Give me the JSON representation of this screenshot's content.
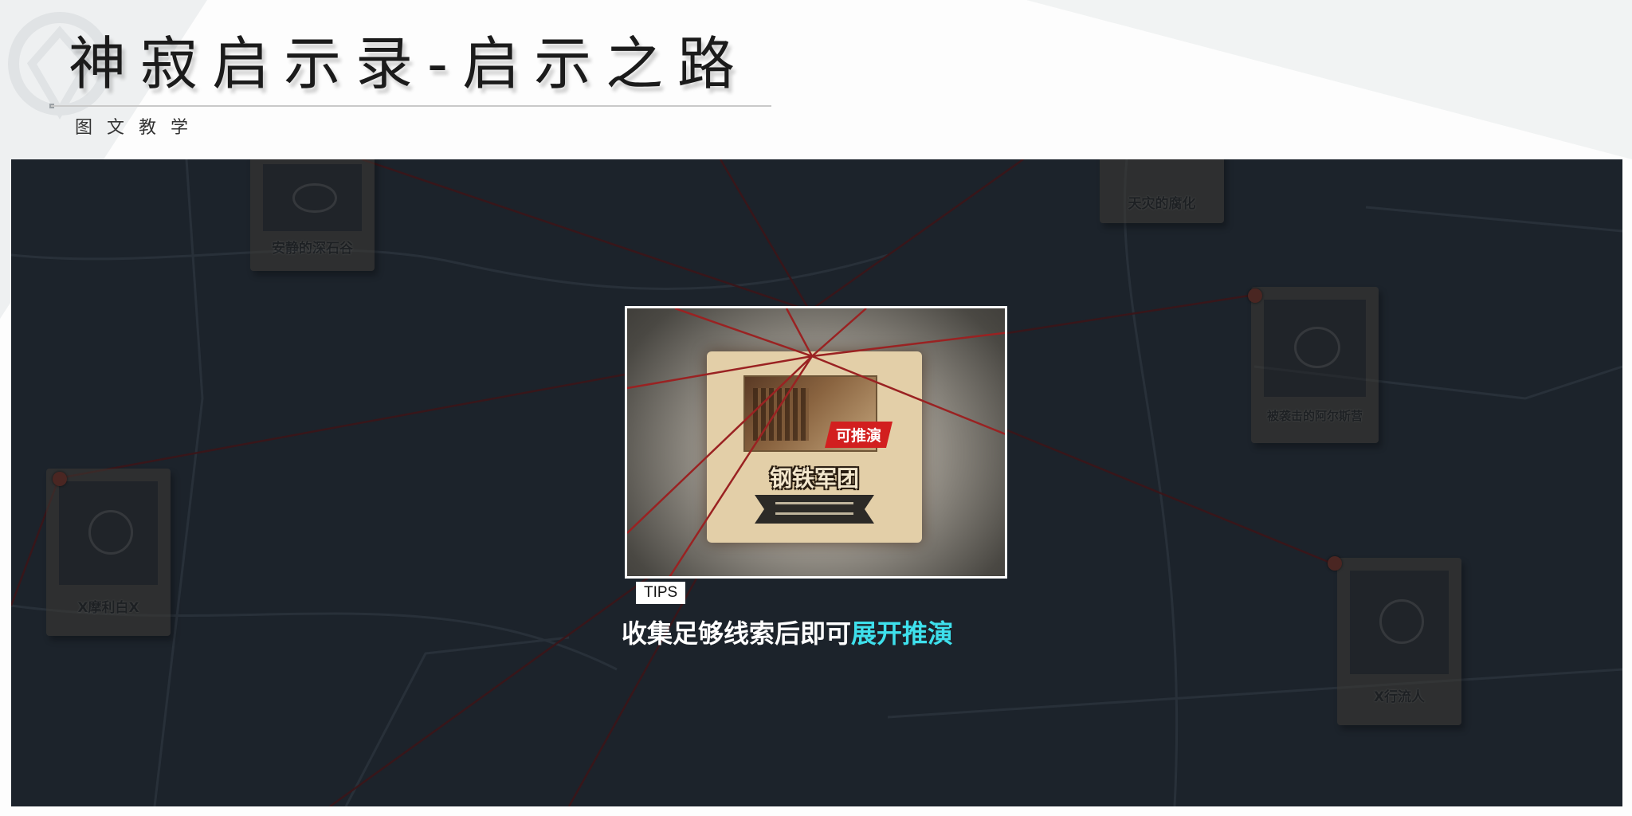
{
  "header": {
    "title": "神寂启示录-启示之路",
    "subtitle": "图文教学"
  },
  "map_cards": [
    {
      "label": "安静的深石谷"
    },
    {
      "label": "天灾的腐化"
    },
    {
      "label": "被袭击的阿尔斯营"
    },
    {
      "label": "X摩利白X"
    },
    {
      "label": "X行流人"
    }
  ],
  "focus_card": {
    "badge": "可推演",
    "title": "钢铁军团"
  },
  "tips": {
    "tag": "TIPS",
    "caption_plain": "收集足够线索后即可",
    "caption_highlight": "展开推演"
  },
  "colors": {
    "panel_bg": "#1c232b",
    "highlight": "#3ee0ec",
    "badge_red": "#d21f1f",
    "thread_red": "#8a1a1a"
  }
}
